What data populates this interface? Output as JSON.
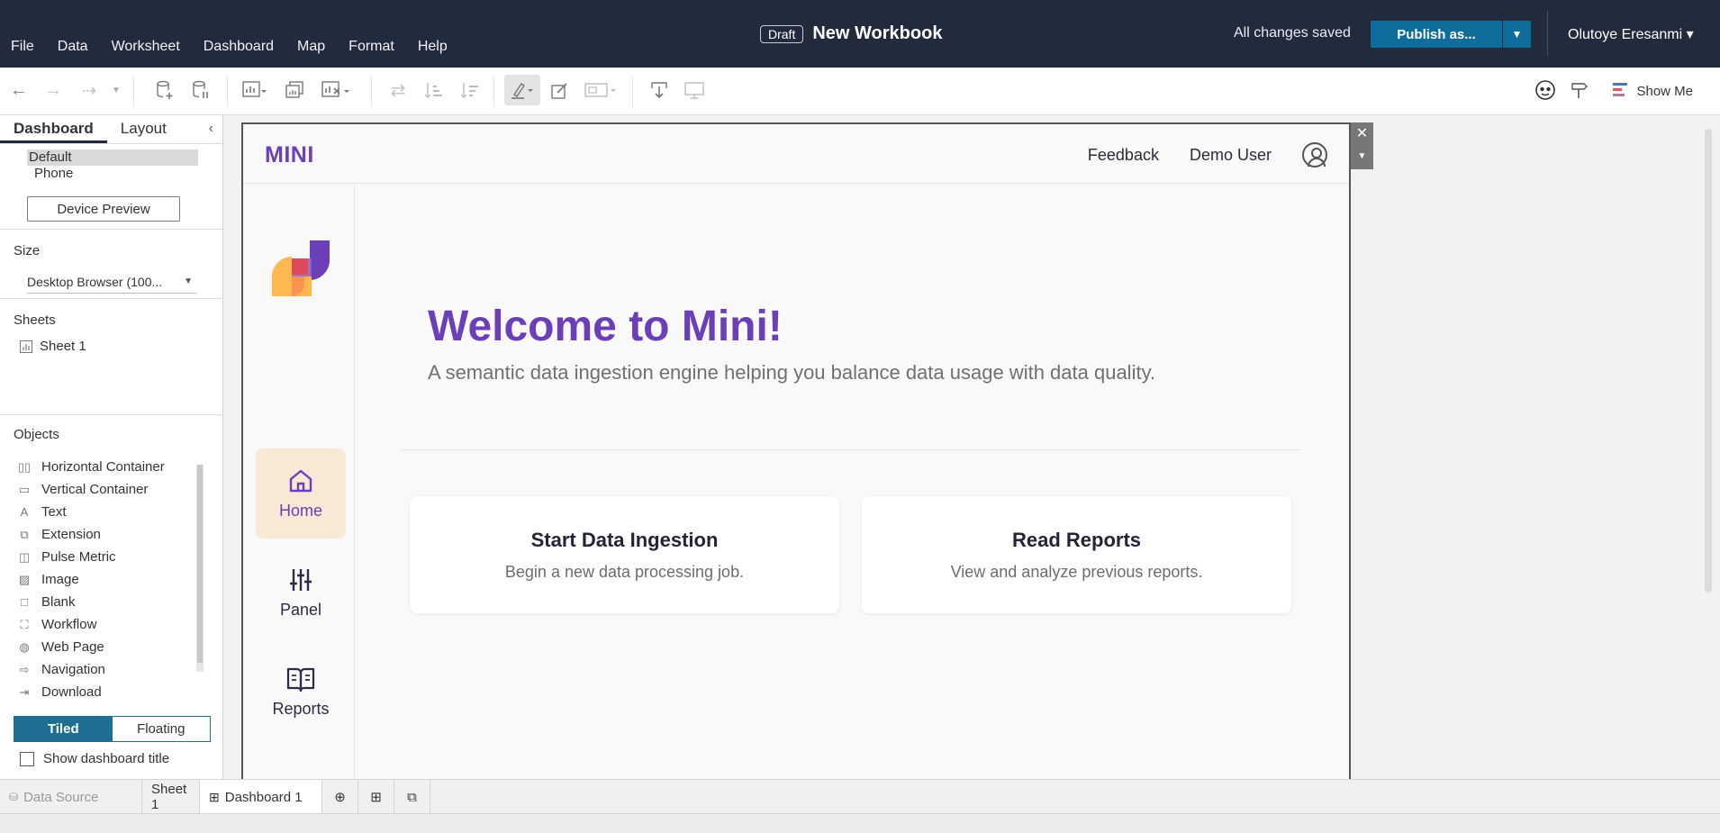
{
  "menu": [
    "File",
    "Data",
    "Worksheet",
    "Dashboard",
    "Map",
    "Format",
    "Help"
  ],
  "header": {
    "draft_badge": "Draft",
    "title": "New Workbook",
    "saved_status": "All changes saved",
    "publish_label": "Publish as...",
    "user_name": "Olutoye Eresanmi ▾"
  },
  "toolbar": {
    "show_me_label": "Show Me"
  },
  "left_panel": {
    "tabs": [
      "Dashboard",
      "Layout"
    ],
    "devices": [
      "Default",
      "Phone"
    ],
    "device_preview_label": "Device Preview",
    "size_label": "Size",
    "size_value": "Desktop Browser (100...",
    "sheets_label": "Sheets",
    "sheets": [
      "Sheet 1"
    ],
    "objects_label": "Objects",
    "objects": [
      "Horizontal Container",
      "Vertical Container",
      "Text",
      "Extension",
      "Pulse Metric",
      "Image",
      "Blank",
      "Workflow",
      "Web Page",
      "Navigation",
      "Download"
    ],
    "tiled_label": "Tiled",
    "floating_label": "Floating",
    "show_title_label": "Show dashboard title"
  },
  "dashboard": {
    "brand": "MINI",
    "feedback_label": "Feedback",
    "user_label": "Demo User",
    "nav": [
      "Home",
      "Panel",
      "Reports"
    ],
    "welcome": "Welcome to Mini!",
    "subtitle": "A semantic data ingestion engine helping you balance data usage with data quality.",
    "cards": [
      {
        "title": "Start Data Ingestion",
        "desc": "Begin a new data processing job."
      },
      {
        "title": "Read Reports",
        "desc": "View and analyze previous reports."
      }
    ]
  },
  "sheet_tabs": {
    "data_source": "Data Source",
    "sheet1": "Sheet 1",
    "dashboard1": "Dashboard 1"
  },
  "colors": {
    "topbar": "#222a3d",
    "publish": "#0f6d9c",
    "brand_purple": "#6a3fb8",
    "nav_active_bg": "#f8e8d6"
  }
}
